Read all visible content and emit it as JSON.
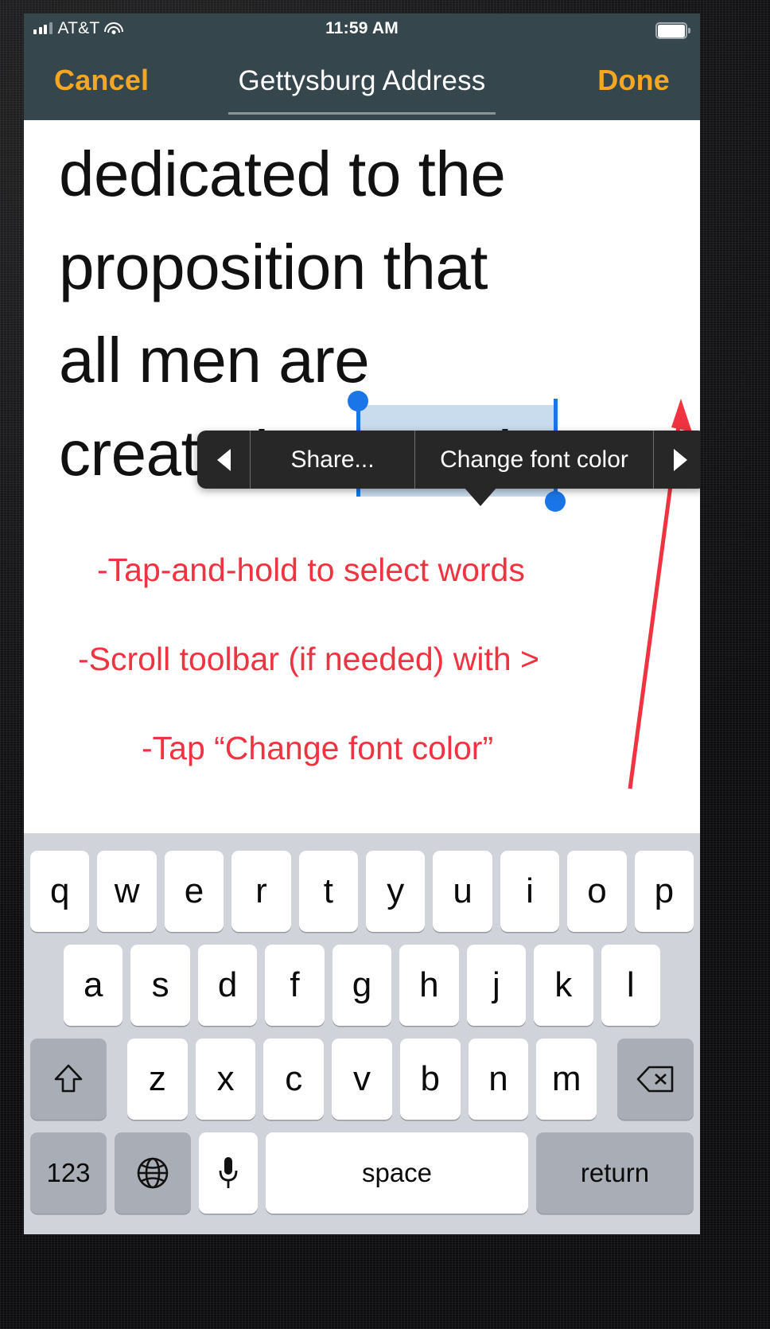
{
  "status_bar": {
    "carrier": "AT&T",
    "time": "11:59 AM",
    "signal_icon": "cellular-signal-icon",
    "wifi_icon": "wifi-icon",
    "battery_icon": "battery-full-icon"
  },
  "nav_bar": {
    "cancel_label": "Cancel",
    "title": "Gettysburg Address",
    "done_label": "Done",
    "accent_color": "#f5a623",
    "bar_color": "#36464d"
  },
  "document": {
    "lines": [
      "dedicated to the",
      "proposition that",
      "all men are",
      "created "
    ],
    "selected_word": "equal",
    "trailing_text": ".",
    "selection_highlight_color": "#c9dced",
    "selection_handle_color": "#1a76e8"
  },
  "edit_menu": {
    "prev_icon": "triangle-left-icon",
    "share_label": "Share...",
    "change_color_label": "Change font color",
    "next_icon": "triangle-right-icon",
    "background_color": "#272727"
  },
  "annotations": {
    "color": "#ef3340",
    "lines": [
      "-Tap-and-hold to select words",
      "-Scroll toolbar (if needed) with >",
      "-Tap “Change font color”"
    ],
    "arrow_icon": "red-arrow-icon"
  },
  "keyboard": {
    "row1": [
      "q",
      "w",
      "e",
      "r",
      "t",
      "y",
      "u",
      "i",
      "o",
      "p"
    ],
    "row2": [
      "a",
      "s",
      "d",
      "f",
      "g",
      "h",
      "j",
      "k",
      "l"
    ],
    "row3_letters": [
      "z",
      "x",
      "c",
      "v",
      "b",
      "n",
      "m"
    ],
    "shift_icon": "shift-up-arrow-icon",
    "delete_icon": "backspace-delete-icon",
    "numbers_label": "123",
    "globe_icon": "globe-language-icon",
    "mic_icon": "microphone-icon",
    "space_label": "space",
    "return_label": "return",
    "key_color": "#ffffff",
    "modifier_key_color": "#a9adb6",
    "keyboard_background": "#d0d3d9"
  }
}
